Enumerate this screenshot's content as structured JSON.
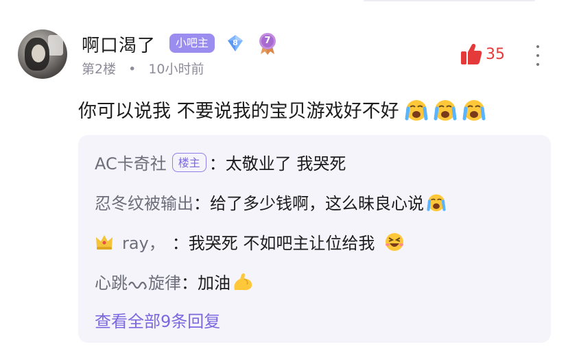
{
  "post": {
    "username": "啊口渴了",
    "role_badge": "小吧主",
    "level": "8",
    "medal_level": "7",
    "floor": "第2楼",
    "time": "10小时前",
    "likes": "35",
    "content": "你可以说我 不要说我的宝贝游戏好不好",
    "accent_color": "#9b8cf0",
    "like_color": "#e53a3a"
  },
  "replies": [
    {
      "name": "AC卡奇社",
      "badge": "楼主",
      "colon": "：",
      "text": "太敬业了 我哭死"
    },
    {
      "name": "忍冬纹被输出",
      "colon": "：",
      "text": "给了多少钱啊，这么昧良心说"
    },
    {
      "name": "ray，",
      "colon": "：",
      "text": "我哭死 不如吧主让位给我"
    },
    {
      "name_a": "心跳",
      "name_b": "旋律",
      "colon": "：",
      "text": "加油"
    }
  ],
  "view_all": "查看全部9条回复",
  "icons": {
    "crying": "loudly-crying-face-icon",
    "crown": "crown-icon",
    "muscle": "flexed-biceps-icon",
    "grin": "grinning-squinting-face-icon",
    "thumb": "thumbs-up-icon",
    "more": "more-vertical-icon",
    "level": "diamond-level-icon",
    "medal": "medal-icon"
  }
}
